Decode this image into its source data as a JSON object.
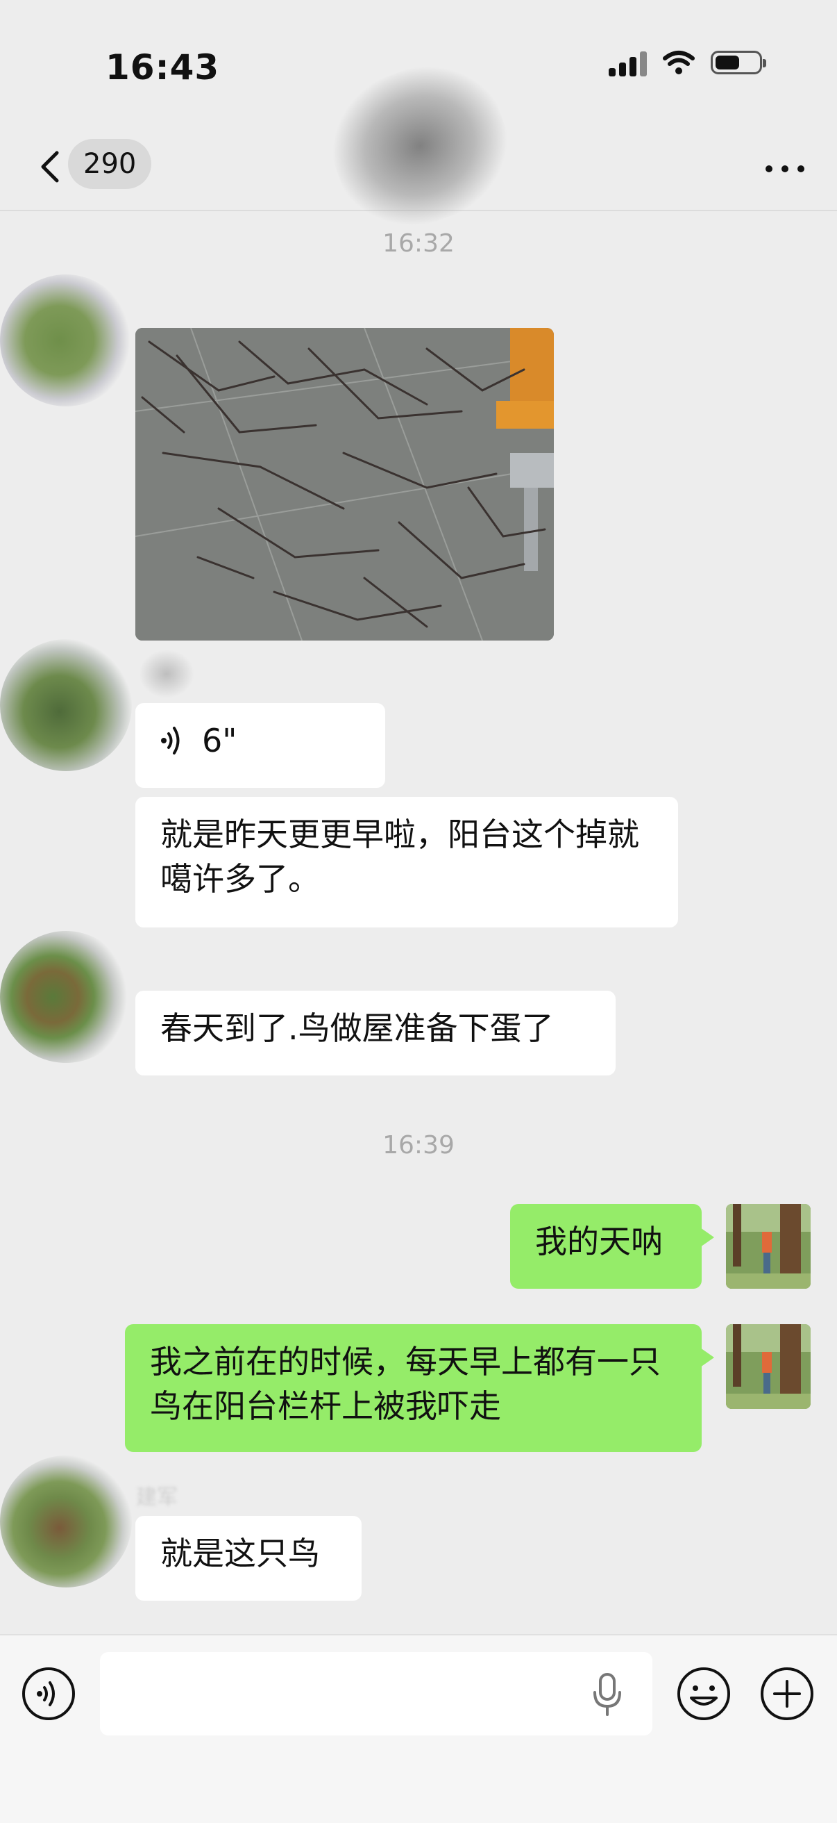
{
  "status_bar": {
    "time": "16:43",
    "icons": [
      "signal-icon",
      "wifi-icon",
      "battery-icon"
    ]
  },
  "nav": {
    "unread_count": "290",
    "icons": [
      "back-icon",
      "more-icon"
    ]
  },
  "messages": {
    "time1": "16:32",
    "voice_duration": "6\"",
    "text1": "就是昨天更更早啦，阳台这个掉就噶许多了。",
    "text2": "春天到了.鸟做屋准备下蛋了",
    "time2": "16:39",
    "mine1": "我的天呐",
    "mine2": "我之前在的时候，每天早上都有一只鸟在阳台栏杆上被我吓走",
    "sender_name_blurred": "建军",
    "text3": "就是这只鸟"
  },
  "input_bar": {
    "icons": [
      "voice-toggle-icon",
      "mic-icon",
      "emoji-icon",
      "plus-icon"
    ]
  },
  "colors": {
    "background": "#ededed",
    "my_bubble": "#95ec69",
    "their_bubble": "#ffffff",
    "timestamp": "#a8a8a8"
  }
}
